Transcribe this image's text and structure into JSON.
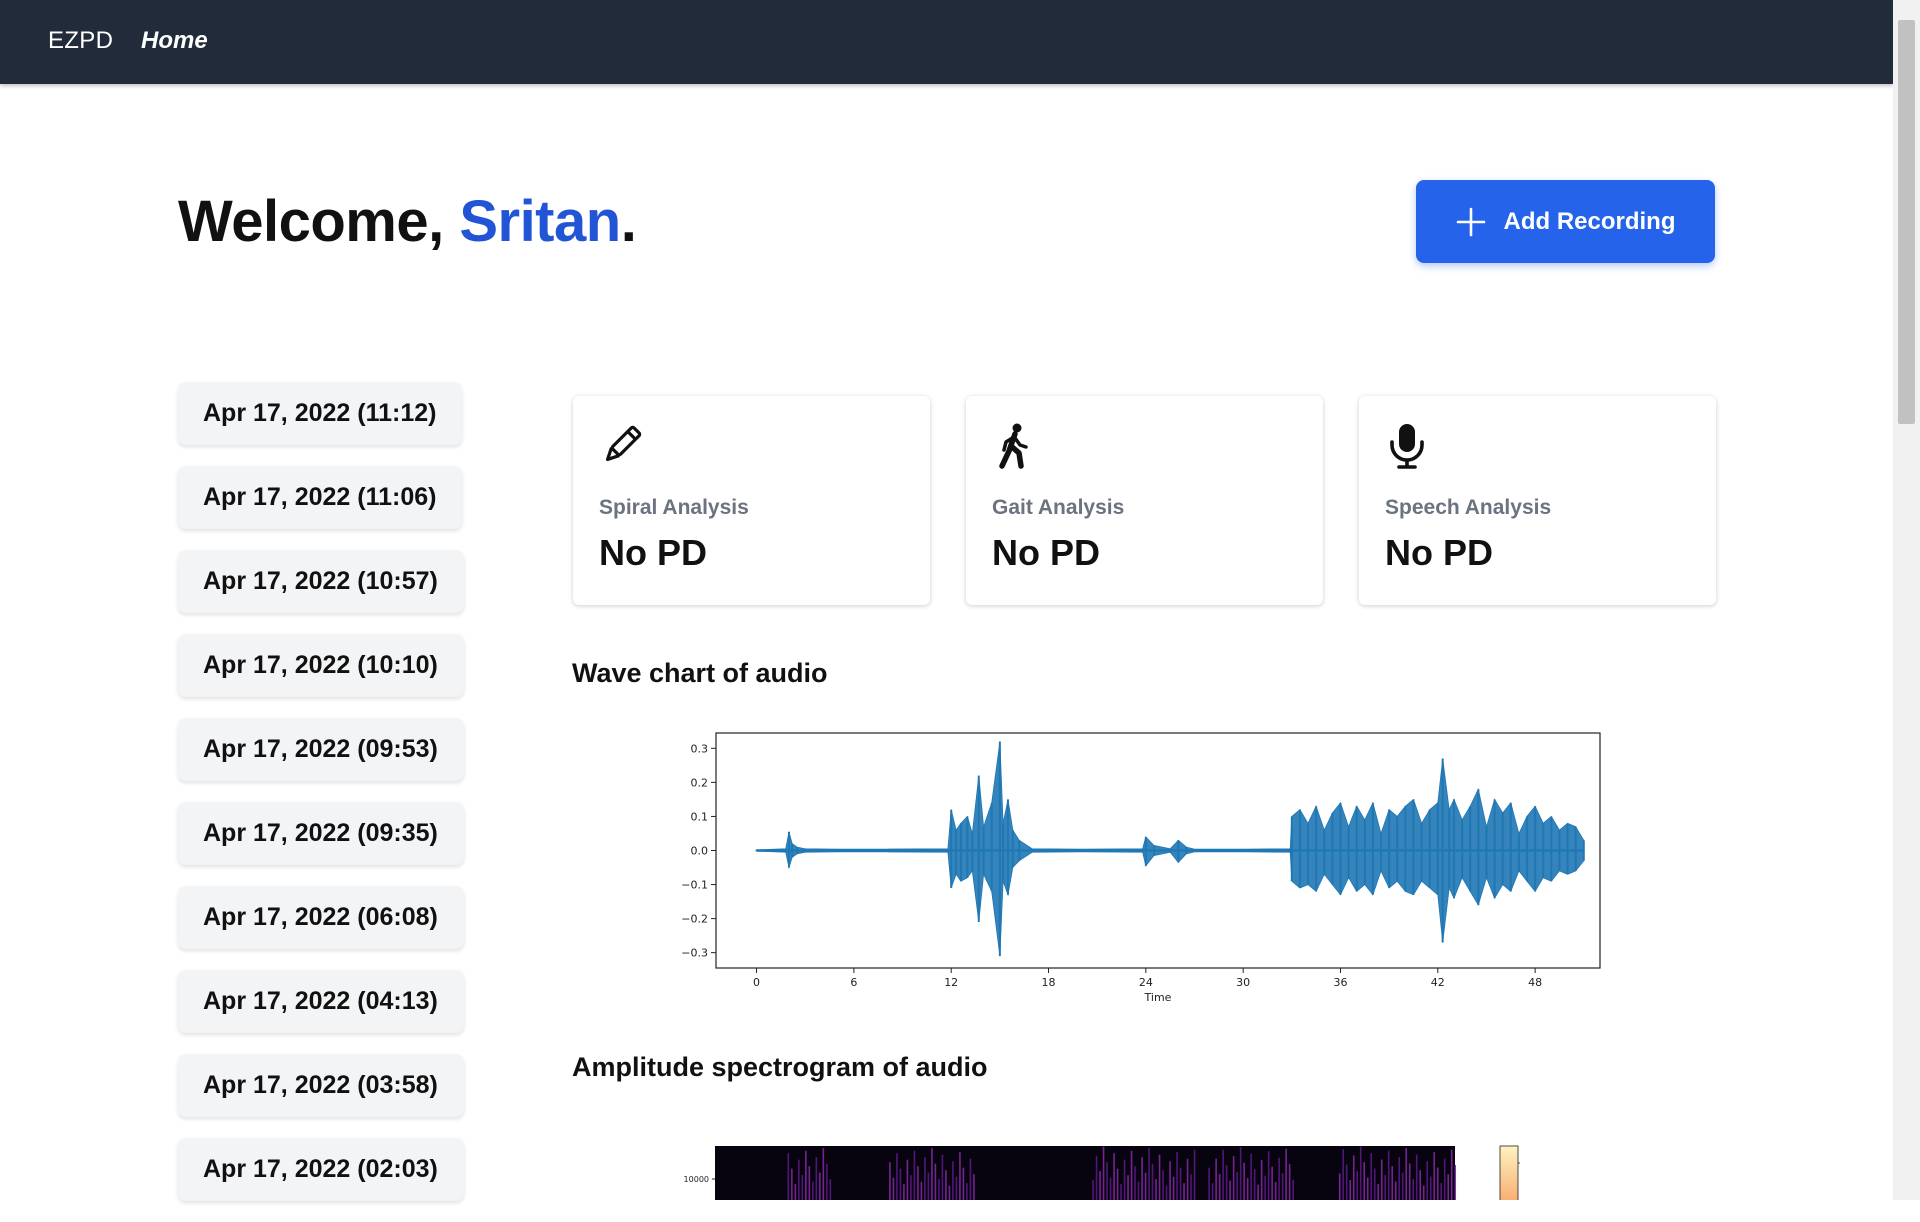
{
  "nav": {
    "brand": "EZPD",
    "home": "Home"
  },
  "welcome": {
    "greeting": "Welcome, ",
    "user": "Sritan",
    "punct": "."
  },
  "add_button": {
    "label": "Add Recording",
    "icon": "plus-icon"
  },
  "sessions": [
    "Apr 17, 2022 (11:12)",
    "Apr 17, 2022 (11:06)",
    "Apr 17, 2022 (10:57)",
    "Apr 17, 2022 (10:10)",
    "Apr 17, 2022 (09:53)",
    "Apr 17, 2022 (09:35)",
    "Apr 17, 2022 (06:08)",
    "Apr 17, 2022 (04:13)",
    "Apr 17, 2022 (03:58)",
    "Apr 17, 2022 (02:03)"
  ],
  "cards": [
    {
      "icon": "pencil-icon",
      "label": "Spiral Analysis",
      "value": "No PD"
    },
    {
      "icon": "walking-person-icon",
      "label": "Gait Analysis",
      "value": "No PD"
    },
    {
      "icon": "microphone-icon",
      "label": "Speech Analysis",
      "value": "No PD"
    }
  ],
  "sections": {
    "wave": "Wave chart of audio",
    "spectrogram": "Amplitude spectrogram of audio"
  },
  "colors": {
    "navbar": "#222b3a",
    "accent": "#2563eb",
    "username": "#2254d6",
    "wave": "#1f77b4",
    "card_label": "#6b7280"
  },
  "chart_data": [
    {
      "type": "line",
      "title": "",
      "xlabel": "Time",
      "ylabel": "",
      "xlim": [
        -2.5,
        52
      ],
      "ylim": [
        -0.345,
        0.345
      ],
      "xticks": [
        0,
        6,
        12,
        18,
        24,
        30,
        36,
        42,
        48
      ],
      "yticks": [
        0.3,
        0.2,
        0.1,
        0.0,
        -0.1,
        -0.2,
        -0.3
      ],
      "ytick_labels": [
        "0.3",
        "0.2",
        "0.1",
        "0.0",
        "−0.1",
        "−0.2",
        "−0.3"
      ],
      "grid": false,
      "series": [
        {
          "x": [
            0,
            1.8,
            2,
            2.2,
            2.5,
            3,
            5,
            8,
            11.8,
            12,
            12.3,
            12.6,
            13,
            13.3,
            13.7,
            14,
            14.5,
            15,
            15.2,
            15.5,
            15.8,
            16.2,
            17,
            20,
            23.8,
            24,
            24.5,
            25.5,
            26,
            26.5,
            27,
            30,
            32.9,
            33,
            33.5,
            34,
            34.5,
            35,
            35.5,
            36,
            36.5,
            37,
            37.5,
            38,
            38.5,
            39,
            39.5,
            40,
            40.5,
            41,
            41.5,
            42,
            42.3,
            42.7,
            43,
            43.5,
            44,
            44.5,
            45,
            45.5,
            46,
            46.5,
            47,
            47.5,
            48,
            48.5,
            49,
            49.5,
            50,
            50.5,
            51
          ],
          "y_top": [
            0.002,
            0.005,
            0.055,
            0.02,
            0.01,
            0.005,
            0.004,
            0.004,
            0.005,
            0.12,
            0.06,
            0.08,
            0.1,
            0.05,
            0.22,
            0.07,
            0.14,
            0.32,
            0.08,
            0.15,
            0.06,
            0.03,
            0.005,
            0.004,
            0.005,
            0.04,
            0.015,
            0.005,
            0.03,
            0.01,
            0.004,
            0.004,
            0.005,
            0.1,
            0.12,
            0.08,
            0.13,
            0.06,
            0.11,
            0.14,
            0.07,
            0.13,
            0.09,
            0.14,
            0.05,
            0.12,
            0.1,
            0.13,
            0.15,
            0.08,
            0.12,
            0.14,
            0.27,
            0.12,
            0.15,
            0.09,
            0.13,
            0.18,
            0.07,
            0.15,
            0.11,
            0.14,
            0.05,
            0.1,
            0.13,
            0.08,
            0.1,
            0.06,
            0.08,
            0.07,
            0.03
          ],
          "y_bottom": [
            -0.002,
            -0.005,
            -0.05,
            -0.02,
            -0.01,
            -0.005,
            -0.004,
            -0.004,
            -0.005,
            -0.11,
            -0.07,
            -0.09,
            -0.08,
            -0.06,
            -0.21,
            -0.07,
            -0.12,
            -0.31,
            -0.09,
            -0.13,
            -0.05,
            -0.03,
            -0.005,
            -0.004,
            -0.005,
            -0.045,
            -0.015,
            -0.005,
            -0.035,
            -0.01,
            -0.004,
            -0.004,
            -0.005,
            -0.09,
            -0.11,
            -0.1,
            -0.12,
            -0.07,
            -0.1,
            -0.13,
            -0.08,
            -0.12,
            -0.1,
            -0.13,
            -0.06,
            -0.11,
            -0.09,
            -0.12,
            -0.13,
            -0.09,
            -0.11,
            -0.13,
            -0.27,
            -0.11,
            -0.14,
            -0.08,
            -0.12,
            -0.16,
            -0.08,
            -0.14,
            -0.1,
            -0.12,
            -0.06,
            -0.09,
            -0.12,
            -0.08,
            -0.09,
            -0.06,
            -0.07,
            -0.06,
            -0.03
          ]
        }
      ]
    },
    {
      "type": "heatmap",
      "title": "",
      "yticks": [
        10000
      ],
      "ytick_labels": [
        "10000"
      ],
      "colorbar_ticks": [
        "+30"
      ],
      "activity_bands": [
        [
          5,
          8
        ],
        [
          12,
          18
        ],
        [
          26,
          33
        ],
        [
          34,
          40
        ],
        [
          43,
          51
        ]
      ]
    }
  ]
}
